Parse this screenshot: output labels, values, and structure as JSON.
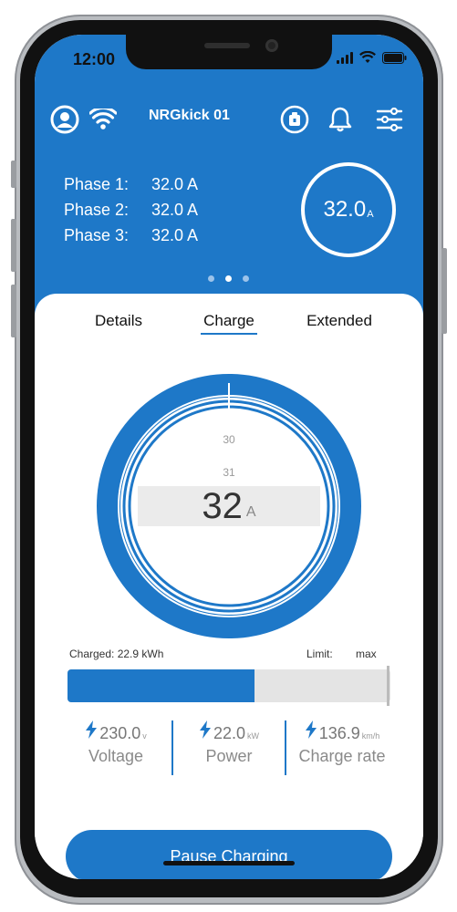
{
  "status_bar": {
    "time": "12:00"
  },
  "header": {
    "device_name": "NRGkick 01"
  },
  "phases": [
    {
      "label": "Phase  1:",
      "value": "32.0 A"
    },
    {
      "label": "Phase  2:",
      "value": "32.0 A"
    },
    {
      "label": "Phase  3:",
      "value": "32.0 A"
    }
  ],
  "total_current": {
    "value": "32.0",
    "unit": "A"
  },
  "pager": {
    "count": 3,
    "active_index": 1
  },
  "tabs": [
    {
      "label": "Details",
      "active": false
    },
    {
      "label": "Charge",
      "active": true
    },
    {
      "label": "Extended",
      "active": false
    }
  ],
  "current_picker": {
    "labels_above": [
      "30",
      "31"
    ],
    "selected_value": "32",
    "unit": "A"
  },
  "charging": {
    "charged_label": "Charged: 22.9 kWh",
    "limit_label": "Limit:",
    "limit_value": "max",
    "progress_fraction": 0.58
  },
  "stats": [
    {
      "value": "230.0",
      "unit": "v",
      "name": "Voltage"
    },
    {
      "value": "22.0",
      "unit": "kW",
      "name": "Power"
    },
    {
      "value": "136.9",
      "unit": "km/h",
      "name": "Charge rate"
    }
  ],
  "actions": {
    "pause_label": "Pause Charging"
  },
  "colors": {
    "brand_blue": "#1e78c8",
    "white": "#ffffff"
  },
  "icons": [
    "user-icon",
    "wifi-icon",
    "charging-station-icon",
    "bell-icon",
    "settings-sliders-icon",
    "lightning-icon",
    "signal-icon",
    "battery-icon"
  ]
}
